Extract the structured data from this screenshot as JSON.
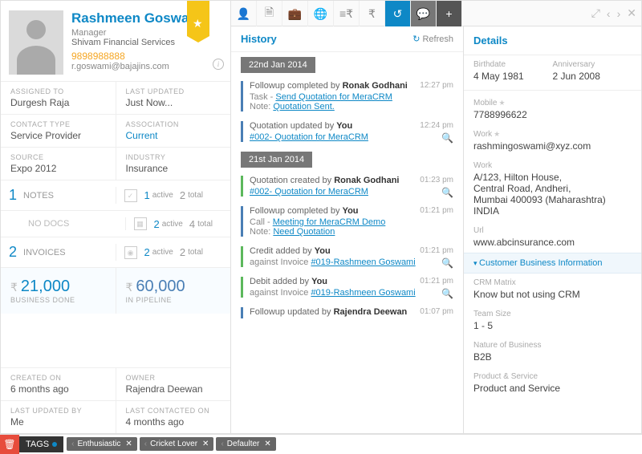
{
  "contact": {
    "name": "Rashmeen Goswami",
    "role": "Manager",
    "company": "Shivam Financial Services",
    "phone": "9898988888",
    "email": "r.goswami@bajajins.com"
  },
  "meta": [
    {
      "label": "ASSIGNED TO",
      "value": "Durgesh Raja"
    },
    {
      "label": "LAST UPDATED",
      "value": "Just Now..."
    },
    {
      "label": "CONTACT TYPE",
      "value": "Service Provider"
    },
    {
      "label": "ASSOCIATION",
      "value": "Current",
      "link": true
    },
    {
      "label": "SOURCE",
      "value": "Expo 2012"
    },
    {
      "label": "INDUSTRY",
      "value": "Insurance"
    }
  ],
  "stats": {
    "notes": {
      "count": "1",
      "label": "NOTES"
    },
    "nodocs": "NO DOCS",
    "invoices": {
      "count": "2",
      "label": "INVOICES"
    },
    "row1": {
      "active": "1",
      "total": "2"
    },
    "row2": {
      "active": "2",
      "total": "4"
    },
    "row3": {
      "active": "2",
      "total": "2"
    },
    "active": "active",
    "totaltxt": "total"
  },
  "money": {
    "done": "21,000",
    "done_lbl": "BUSINESS DONE",
    "pipe": "60,000",
    "pipe_lbl": "IN PIPELINE"
  },
  "footer": [
    {
      "label": "CREATED ON",
      "value": "6 months ago"
    },
    {
      "label": "OWNER",
      "value": "Rajendra Deewan"
    },
    {
      "label": "LAST UPDATED BY",
      "value": "Me"
    },
    {
      "label": "LAST CONTACTED ON",
      "value": "4 months ago"
    }
  ],
  "history": {
    "title": "History",
    "refresh": "Refresh",
    "groups": [
      {
        "date": "22nd Jan 2014",
        "items": [
          {
            "bar": "b",
            "action": "Followup completed by",
            "who": "Ronak Godhani",
            "time": "12:27 pm",
            "sub1": "Task - ",
            "link1": "Send Quotation for MeraCRM",
            "sub2": "Note: ",
            "link2": "Quotation Sent."
          },
          {
            "bar": "b",
            "action": "Quotation updated by",
            "who": "You",
            "time": "12:24 pm",
            "link1": "#002- Quotation for MeraCRM",
            "mag": true
          }
        ]
      },
      {
        "date": "21st Jan 2014",
        "items": [
          {
            "bar": "g",
            "action": "Quotation created by",
            "who": "Ronak Godhani",
            "time": "01:23 pm",
            "link1": "#002- Quotation for MeraCRM",
            "mag": true
          },
          {
            "bar": "b",
            "action": "Followup completed by",
            "who": "You",
            "time": "01:21 pm",
            "sub1": "Call - ",
            "link1": "Meeting for MeraCRM Demo",
            "sub2": "Note: ",
            "link2": "Need Quotation"
          },
          {
            "bar": "g",
            "action": "Credit added by",
            "who": "You",
            "time": "01:21 pm",
            "sub1": "against Invoice ",
            "link1": "#019-Rashmeen Goswami",
            "mag": true
          },
          {
            "bar": "g",
            "action": "Debit added by",
            "who": "You",
            "time": "01:21 pm",
            "sub1": "against Invoice ",
            "link1": "#019-Rashmeen Goswami",
            "mag": true
          },
          {
            "bar": "b",
            "action": "Followup updated by",
            "who": "Rajendra Deewan",
            "time": "01:07 pm"
          }
        ]
      }
    ]
  },
  "details": {
    "title": "Details",
    "birthdate_lbl": "Birthdate",
    "birthdate": "4 May 1981",
    "anniv_lbl": "Anniversary",
    "anniv": "2 Jun 2008",
    "mobile_lbl": "Mobile",
    "mobile": "7788996622",
    "work_email_lbl": "Work",
    "work_email": "rashmingoswami@xyz.com",
    "work_addr_lbl": "Work",
    "work_addr": "A/123, Hilton House,\nCentral Road, Andheri,\nMumbai 400093 (Maharashtra) INDIA",
    "url_lbl": "Url",
    "url": "www.abcinsurance.com",
    "section": "Customer Business Information",
    "biz": [
      {
        "label": "CRM Matrix",
        "value": "Know but not using CRM"
      },
      {
        "label": "Team Size",
        "value": "1 - 5"
      },
      {
        "label": "Nature of Business",
        "value": "B2B"
      },
      {
        "label": "Product & Service",
        "value": "Product and Service"
      }
    ]
  },
  "tags": {
    "label": "TAGS",
    "items": [
      "Enthusiastic",
      "Cricket Lover",
      "Defaulter"
    ]
  }
}
